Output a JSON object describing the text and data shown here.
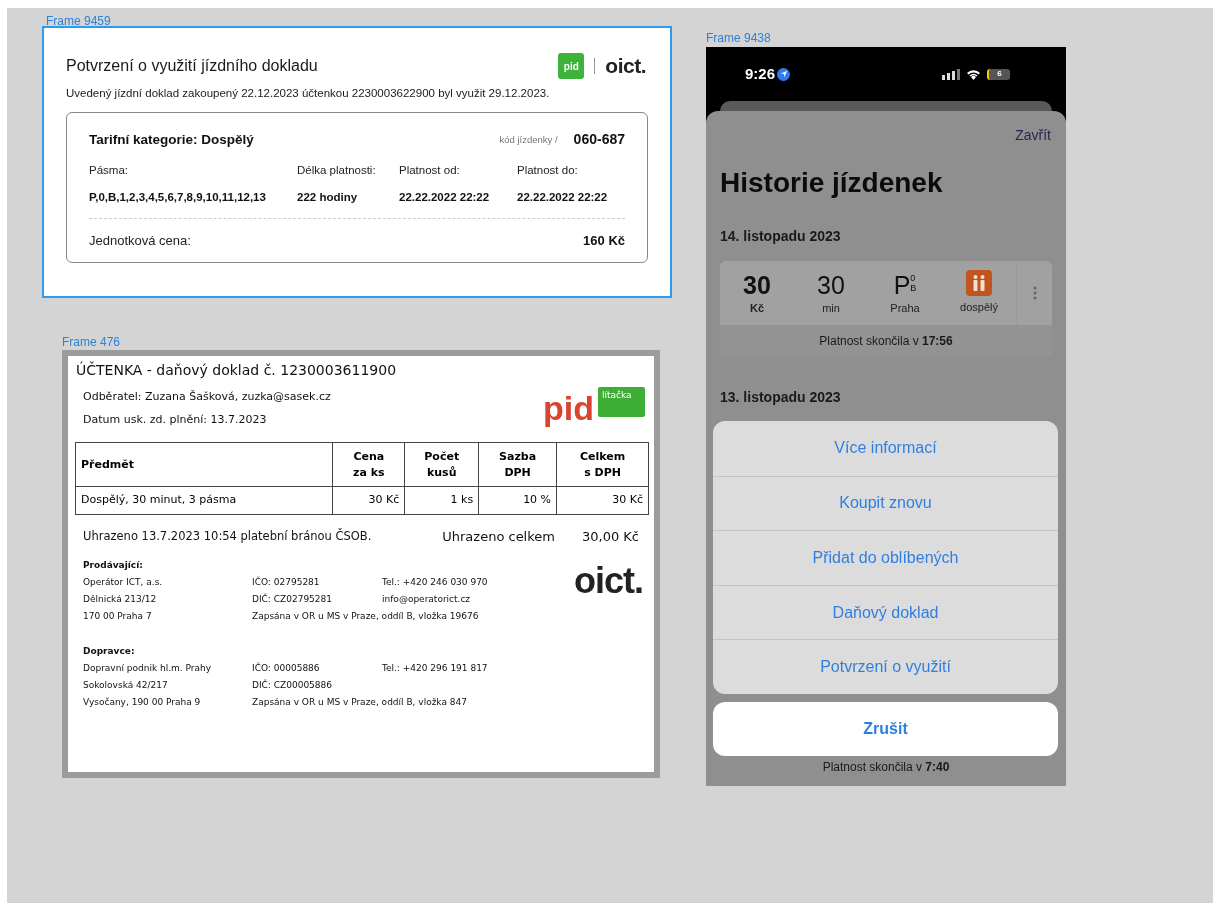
{
  "frames": [
    {
      "label": "Frame 9459",
      "selected": true
    },
    {
      "label": "Frame 476",
      "selected": false
    },
    {
      "label": "Frame 9438",
      "selected": false
    }
  ],
  "confirmation": {
    "title": "Potvrzení o využití jízdního dokladu",
    "pid_logo": "pid",
    "oict_logo": "oict.",
    "text": "Uvedený jízdní doklad zakoupený 22.12.2023 účtenkou 2230003622900 byl využit 29.12.2023.",
    "category": "Tarifní kategorie: Dospělý",
    "code_label": "kód jízdenky /",
    "code": "060-687",
    "fields": [
      {
        "label": "Pásma:",
        "value": "P,0,B,1,2,3,4,5,6,7,8,9,10,11,12,13"
      },
      {
        "label": "Délka platnosti:",
        "value": "222 hodiny"
      },
      {
        "label": "Platnost od:",
        "value": "22.22.2022 22:22"
      },
      {
        "label": "Platnost do:",
        "value": "22.22.2022 22:22"
      }
    ],
    "price_label": "Jednotková cena:",
    "price": "160 Kč"
  },
  "receipt": {
    "title": "ÚČTENKA - daňový doklad č. 1230003611900",
    "customer": [
      "Odběratel: Zuzana Šašková, zuzka@sasek.cz",
      "Datum usk. zd. plnění: 13.7.2023"
    ],
    "pid_logo": "pid",
    "badge": "lítačka",
    "columns": [
      "Předmět",
      "Cena\nza ks",
      "Počet\nkusů",
      "Sazba\nDPH",
      "Celkem\ns DPH"
    ],
    "rows": [
      [
        "Dospělý, 30 minut, 3 pásma",
        "30 Kč",
        "1 ks",
        "10 %",
        "30 Kč"
      ]
    ],
    "paid_text": "Uhrazeno 13.7.2023 10:54 platební bránou ČSOB.",
    "total_label": "Uhrazeno celkem",
    "total_value": "30,00 Kč",
    "oict_logo": "oict.",
    "sections": [
      {
        "heading": "Prodávající:",
        "rows": [
          [
            "Operátor ICT, a.s.",
            "IČO: 02795281",
            "Tel.: +420 246 030 970"
          ],
          [
            "Dělnická 213/12",
            "DIČ: CZ02795281",
            "info@operatorict.cz"
          ],
          [
            "170 00 Praha 7",
            "Zapsána v OR u MS v Praze, oddíl B, vložka 19676",
            ""
          ]
        ]
      },
      {
        "heading": "Dopravce:",
        "rows": [
          [
            "Dopravní podnik hl.m. Prahy",
            "IČO: 00005886",
            "Tel.: +420 296 191 817"
          ],
          [
            "Sokolovská 42/217",
            "DIČ: CZ00005886",
            ""
          ],
          [
            "Vysočany, 190 00 Praha 9",
            "Zapsána v OR u MS v Praze, oddíl B, vložka 847",
            ""
          ]
        ]
      }
    ]
  },
  "phone": {
    "time": "9:26",
    "battery": "6",
    "close": "Zavřít",
    "title": "Historie jízdenek",
    "date_1": "14. listopadu 2023",
    "ticket": {
      "price": "30",
      "price_unit": "Kč",
      "duration": "30",
      "duration_unit": "min",
      "zone": "P",
      "zone_sup": "0",
      "zone_sub": "B",
      "zone_label": "Praha",
      "category": "dospělý",
      "expired": "Platnost skončila v **17:56**"
    },
    "date_2": "13. listopadu 2023",
    "actions": [
      "Více informací",
      "Koupit znovu",
      "Přidat do oblíbených",
      "Daňový doklad",
      "Potvrzení o využití"
    ],
    "cancel": "Zrušit",
    "bottom_expired": "Platnost skončila v **7:40**"
  }
}
